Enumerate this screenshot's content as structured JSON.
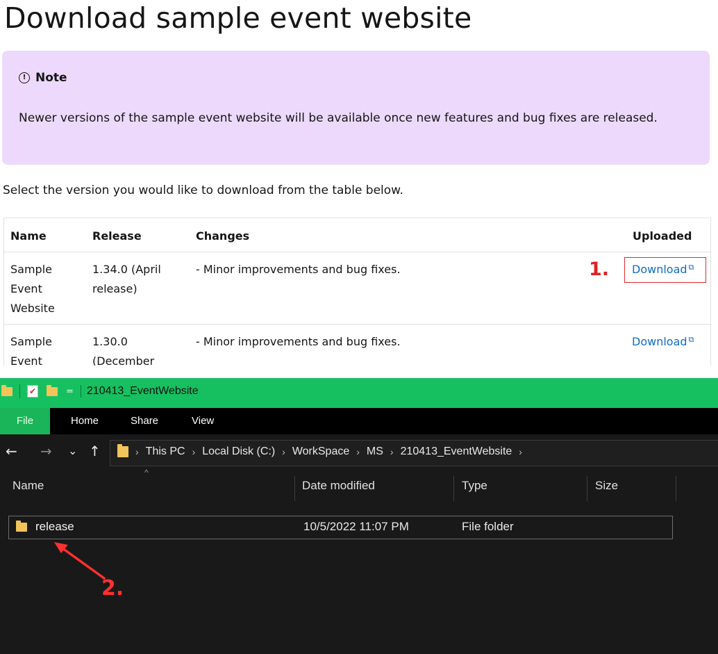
{
  "doc": {
    "title": "Download sample event website",
    "note": {
      "icon": "info-circle-icon",
      "icon_glyph": "!",
      "label": "Note",
      "body": "Newer versions of the sample event website will be available once new features and bug fixes are released."
    },
    "intro": "Select the version you would like to download from the table below.",
    "table": {
      "headers": [
        "Name",
        "Release",
        "Changes",
        "Uploaded"
      ],
      "rows": [
        {
          "name": "Sample Event Website",
          "release": "1.34.0 (April release)",
          "changes": "- Minor improvements and bug fixes.",
          "link": "Download"
        },
        {
          "name": "Sample Event Website",
          "release": "1.30.0 (December",
          "changes": "- Minor improvements and bug fixes.",
          "link": "Download"
        }
      ],
      "external_glyph": "⧉"
    },
    "callout_1": "1."
  },
  "explorer": {
    "window_title": "210413_EventWebsite",
    "qa_dropdown": "=",
    "ribbon_tabs": [
      "File",
      "Home",
      "Share",
      "View"
    ],
    "nav": {
      "back": "←",
      "forward": "→",
      "recent": "⌄",
      "up": "↑"
    },
    "breadcrumb": [
      "This PC",
      "Local Disk (C:)",
      "WorkSpace",
      "MS",
      "210413_EventWebsite"
    ],
    "breadcrumb_sep": "›",
    "columns": [
      "Name",
      "Date modified",
      "Type",
      "Size"
    ],
    "sort_caret": "^",
    "files": [
      {
        "name": "release",
        "date_modified": "10/5/2022 11:07 PM",
        "type": "File folder",
        "size": ""
      }
    ],
    "callout_2": "2.",
    "colors": {
      "titlebar": "#16c060",
      "ribbon_file": "#19b558",
      "background": "#191919",
      "annotation_red": "#e02027"
    }
  }
}
